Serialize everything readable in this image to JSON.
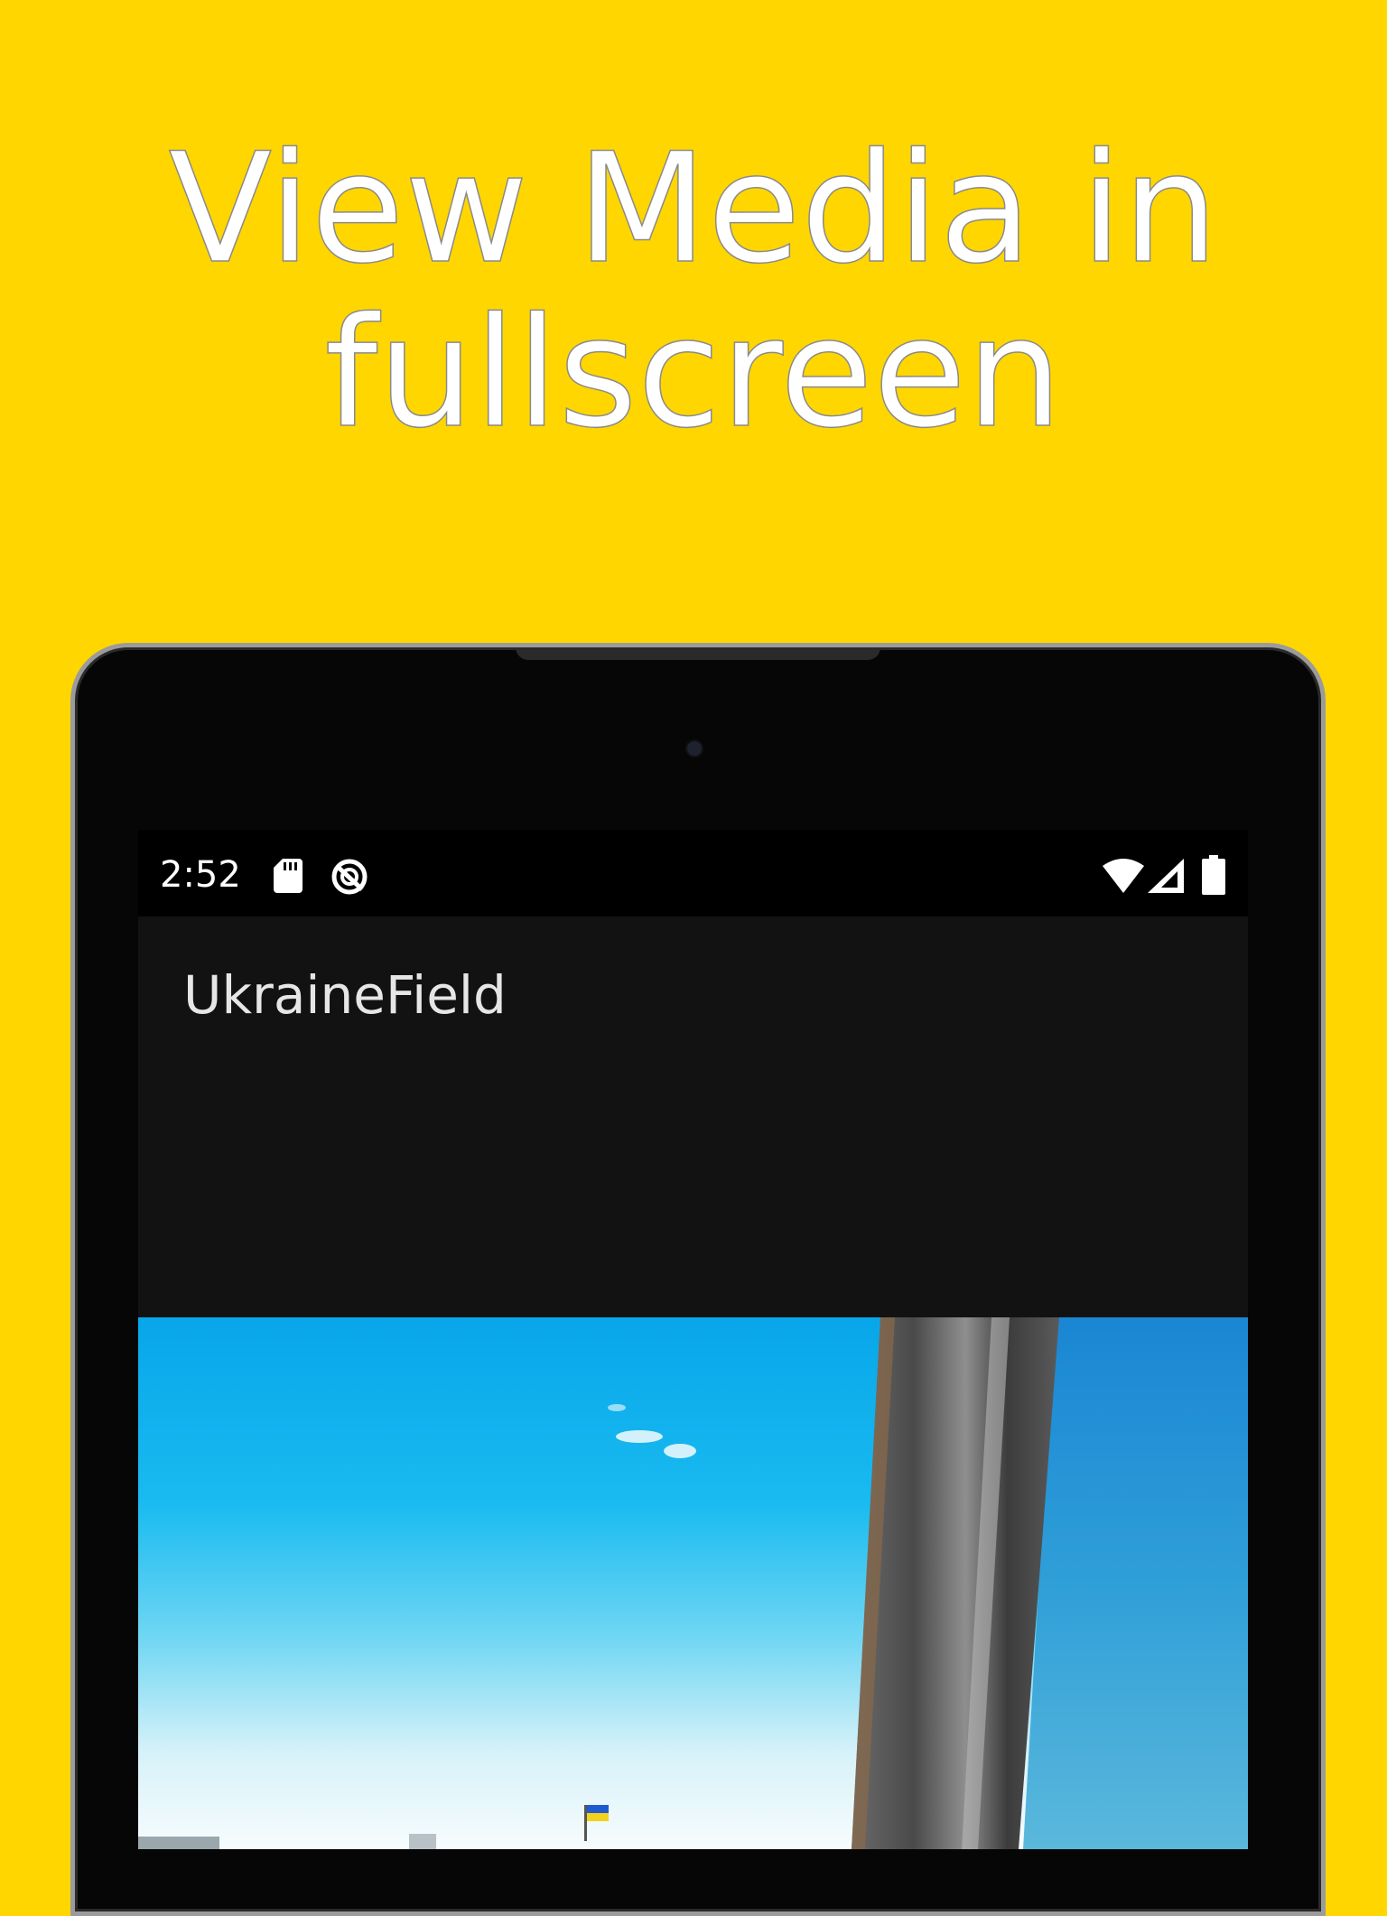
{
  "promo": {
    "headline_line1": "View Media in",
    "headline_line2": "fullscreen",
    "background_color": "#FFD600"
  },
  "status_bar": {
    "time": "2:52",
    "icons": [
      "sd-card-icon",
      "sync-off-icon",
      "wifi-icon",
      "cell-signal-icon",
      "battery-icon"
    ]
  },
  "app_bar": {
    "title": "UkraineField"
  },
  "media": {
    "description_icon": "photo-image"
  }
}
